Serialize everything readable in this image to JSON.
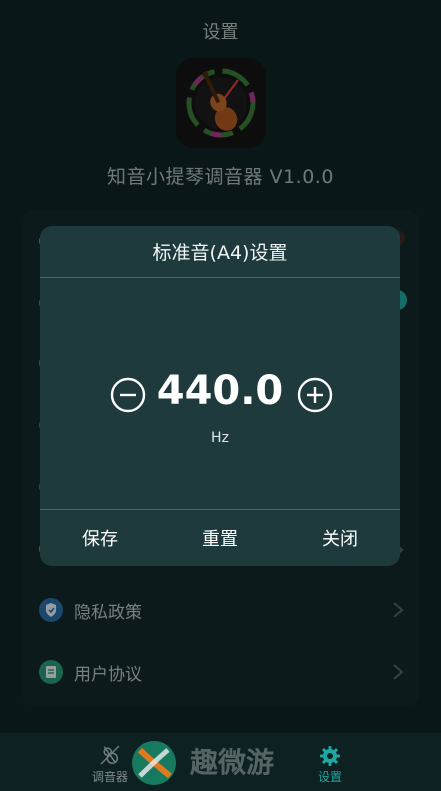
{
  "header": {
    "title": "设置"
  },
  "app": {
    "name": "知音小提琴调音器 V1.0.0"
  },
  "settings": {
    "items": [
      {
        "label": "隐私政策",
        "icon": "shield-icon"
      },
      {
        "label": "用户协议",
        "icon": "document-icon"
      }
    ]
  },
  "dialog": {
    "title": "标准音(A4)设置",
    "frequency": "440.0",
    "unit": "Hz",
    "buttons": {
      "save": "保存",
      "reset": "重置",
      "close": "关闭"
    }
  },
  "tabbar": {
    "tabs": [
      {
        "label": "调音器",
        "icon": "violin-tuner-icon"
      },
      {
        "label": "设置",
        "icon": "gear-icon",
        "active": true
      }
    ]
  },
  "watermark": {
    "text": "趣微游"
  },
  "colors": {
    "accent": "#1fa8a0",
    "background": "#0f2426",
    "dialog": "#1e3a3c"
  }
}
